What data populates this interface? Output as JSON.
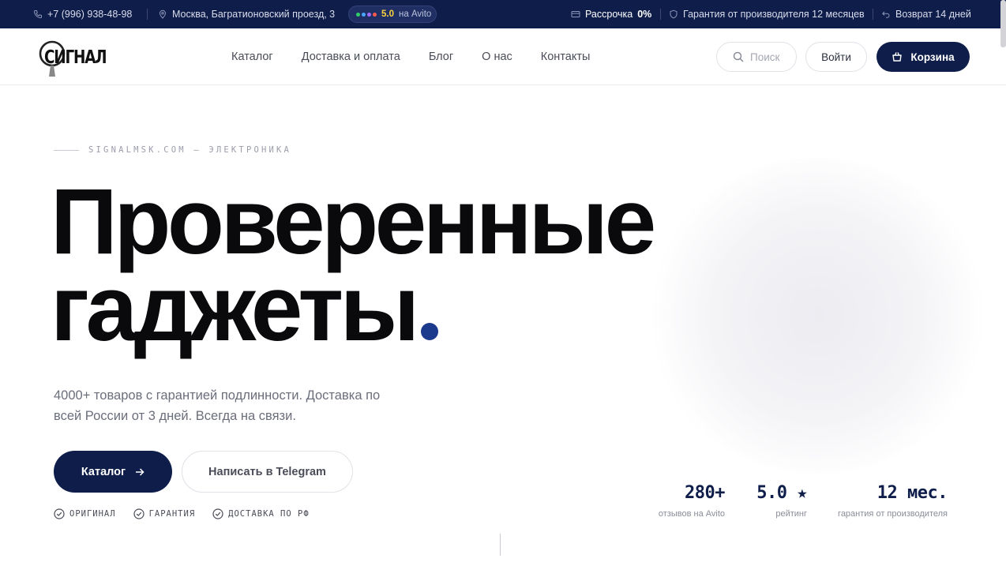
{
  "topbar": {
    "phone": "+7 (996) 938-48-98",
    "address": "Москва, Багратионовский проезд, 3",
    "avito_score": "5.0",
    "avito_label": "на Avito",
    "installment_label": "Рассрочка",
    "installment_value": "0%",
    "warranty": "Гарантия от производителя 12 месяцев",
    "return": "Возврат 14 дней"
  },
  "header": {
    "logo": "СИГНАЛ",
    "nav": [
      "Каталог",
      "Доставка и оплата",
      "Блог",
      "О нас",
      "Контакты"
    ],
    "search_label": "Поиск",
    "login_label": "Войти",
    "cart_label": "Корзина"
  },
  "hero": {
    "eyebrow": "SIGNALMSK.COM — ЭЛЕКТРОНИКА",
    "title_line1": "Проверенные",
    "title_line2": "гаджеты",
    "lead": "4000+ товаров с гарантией подлинности. Доставка по всей России от 3 дней. Всегда на связи.",
    "catalog_button": "Каталог",
    "telegram_button": "Написать в Telegram",
    "badges": [
      "ОРИГИНАЛ",
      "ГАРАНТИЯ",
      "ДОСТАВКА ПО РФ"
    ],
    "stats": [
      {
        "value": "280+",
        "label": "отзывов на Avito"
      },
      {
        "value": "5.0 ★",
        "label": "рейтинг"
      },
      {
        "value": "12 мес.",
        "label": "гарантия от производителя"
      }
    ]
  },
  "colors": {
    "navy": "#0f1d4a",
    "accent_dot": "#1c3a8c",
    "avito_yellow": "#ffd23f"
  }
}
